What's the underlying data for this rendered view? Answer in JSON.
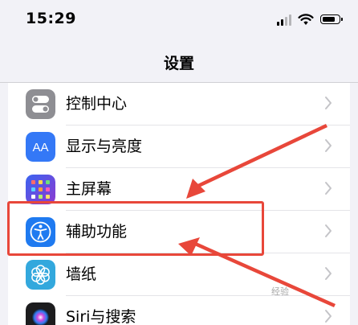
{
  "status_bar": {
    "time": "15:29",
    "icons": [
      "cellular-signal-icon",
      "wifi-icon",
      "battery-icon"
    ]
  },
  "nav": {
    "title": "设置"
  },
  "settings": {
    "items": [
      {
        "label": "控制中心",
        "icon": "toggle-switches-icon",
        "icon_color": "#8e8e93"
      },
      {
        "label": "显示与亮度",
        "icon": "text-size-aa-icon",
        "icon_color": "#3478f6"
      },
      {
        "label": "主屏幕",
        "icon": "app-grid-icon",
        "icon_color": "#5a48d8"
      },
      {
        "label": "辅助功能",
        "icon": "accessibility-person-icon",
        "icon_color": "#1f7af0"
      },
      {
        "label": "墙纸",
        "icon": "flower-icon",
        "icon_color": "#33a8dd"
      },
      {
        "label": "Siri与搜索",
        "icon": "siri-orb-icon",
        "icon_color": "#1c1c1e"
      }
    ]
  },
  "annotations": {
    "highlighted_item": "辅助功能",
    "accent_color": "#e8473a",
    "watermark": "经验"
  }
}
